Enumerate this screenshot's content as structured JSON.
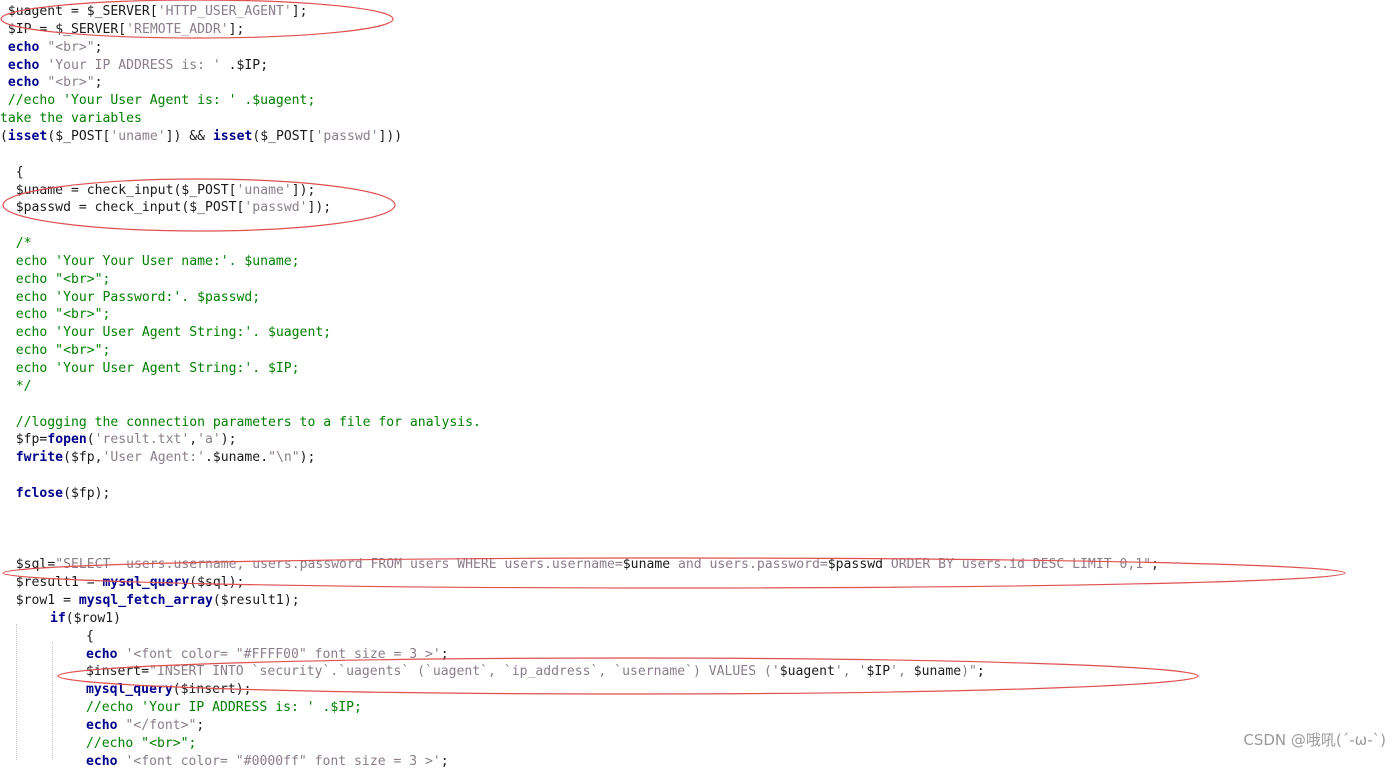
{
  "code_lines": [
    {
      "indent": 0,
      "tokens": [
        [
          "var",
          " $uagent"
        ],
        [
          "op",
          " = "
        ],
        [
          "var",
          "$_SERVER"
        ],
        [
          "punc",
          "["
        ],
        [
          "str",
          "'HTTP_USER_AGENT'"
        ],
        [
          "punc",
          "];"
        ]
      ]
    },
    {
      "indent": 0,
      "tokens": [
        [
          "var",
          " $IP"
        ],
        [
          "op",
          " = "
        ],
        [
          "var",
          "$_SERVER"
        ],
        [
          "punc",
          "["
        ],
        [
          "str",
          "'REMOTE_ADDR'"
        ],
        [
          "punc",
          "];"
        ]
      ]
    },
    {
      "indent": 0,
      "tokens": [
        [
          "kw",
          " echo"
        ],
        [
          "op",
          " "
        ],
        [
          "str",
          "\"<br>\""
        ],
        [
          "punc",
          ";"
        ]
      ]
    },
    {
      "indent": 0,
      "tokens": [
        [
          "kw",
          " echo"
        ],
        [
          "op",
          " "
        ],
        [
          "str",
          "'Your IP ADDRESS is: '"
        ],
        [
          "op",
          " ."
        ],
        [
          "var",
          "$IP"
        ],
        [
          "punc",
          ";"
        ]
      ]
    },
    {
      "indent": 0,
      "tokens": [
        [
          "kw",
          " echo"
        ],
        [
          "op",
          " "
        ],
        [
          "str",
          "\"<br>\""
        ],
        [
          "punc",
          ";"
        ]
      ]
    },
    {
      "indent": 0,
      "tokens": [
        [
          "cmt",
          " //echo 'Your User Agent is: ' .$uagent;"
        ]
      ]
    },
    {
      "indent": 0,
      "tokens": [
        [
          "cmt",
          "take the variables"
        ]
      ]
    },
    {
      "indent": 0,
      "tokens": [
        [
          "punc",
          "("
        ],
        [
          "kw",
          "isset"
        ],
        [
          "punc",
          "("
        ],
        [
          "var",
          "$_POST"
        ],
        [
          "punc",
          "["
        ],
        [
          "str",
          "'uname'"
        ],
        [
          "punc",
          "])"
        ],
        [
          "op",
          " && "
        ],
        [
          "kw",
          "isset"
        ],
        [
          "punc",
          "("
        ],
        [
          "var",
          "$_POST"
        ],
        [
          "punc",
          "["
        ],
        [
          "str",
          "'passwd'"
        ],
        [
          "punc",
          "]))"
        ]
      ]
    },
    {
      "indent": 0,
      "tokens": []
    },
    {
      "indent": 0,
      "tokens": [
        [
          "punc",
          "  {"
        ]
      ]
    },
    {
      "indent": 0,
      "tokens": [
        [
          "var",
          "  $uname"
        ],
        [
          "op",
          " = "
        ],
        [
          "fn",
          "check_input"
        ],
        [
          "punc",
          "("
        ],
        [
          "var",
          "$_POST"
        ],
        [
          "punc",
          "["
        ],
        [
          "str",
          "'uname'"
        ],
        [
          "punc",
          "]);"
        ]
      ]
    },
    {
      "indent": 0,
      "tokens": [
        [
          "var",
          "  $passwd"
        ],
        [
          "op",
          " = "
        ],
        [
          "fn",
          "check_input"
        ],
        [
          "punc",
          "("
        ],
        [
          "var",
          "$_POST"
        ],
        [
          "punc",
          "["
        ],
        [
          "str",
          "'passwd'"
        ],
        [
          "punc",
          "]);"
        ]
      ]
    },
    {
      "indent": 0,
      "tokens": []
    },
    {
      "indent": 0,
      "tokens": [
        [
          "cmt",
          "  /*"
        ]
      ]
    },
    {
      "indent": 0,
      "tokens": [
        [
          "cmt",
          "  echo 'Your Your User name:'. $uname;"
        ]
      ]
    },
    {
      "indent": 0,
      "tokens": [
        [
          "cmt",
          "  echo \"<br>\";"
        ]
      ]
    },
    {
      "indent": 0,
      "tokens": [
        [
          "cmt",
          "  echo 'Your Password:'. $passwd;"
        ]
      ]
    },
    {
      "indent": 0,
      "tokens": [
        [
          "cmt",
          "  echo \"<br>\";"
        ]
      ]
    },
    {
      "indent": 0,
      "tokens": [
        [
          "cmt",
          "  echo 'Your User Agent String:'. $uagent;"
        ]
      ]
    },
    {
      "indent": 0,
      "tokens": [
        [
          "cmt",
          "  echo \"<br>\";"
        ]
      ]
    },
    {
      "indent": 0,
      "tokens": [
        [
          "cmt",
          "  echo 'Your User Agent String:'. $IP;"
        ]
      ]
    },
    {
      "indent": 0,
      "tokens": [
        [
          "cmt",
          "  */"
        ]
      ]
    },
    {
      "indent": 0,
      "tokens": []
    },
    {
      "indent": 0,
      "tokens": [
        [
          "cmt",
          "  //logging the connection parameters to a file for analysis."
        ]
      ]
    },
    {
      "indent": 0,
      "tokens": [
        [
          "var",
          "  $fp"
        ],
        [
          "op",
          "="
        ],
        [
          "kw",
          "fopen"
        ],
        [
          "punc",
          "("
        ],
        [
          "str",
          "'result.txt'"
        ],
        [
          "punc",
          ","
        ],
        [
          "str",
          "'a'"
        ],
        [
          "punc",
          ");"
        ]
      ]
    },
    {
      "indent": 0,
      "tokens": [
        [
          "kw",
          "  fwrite"
        ],
        [
          "punc",
          "("
        ],
        [
          "var",
          "$fp"
        ],
        [
          "punc",
          ","
        ],
        [
          "str",
          "'User Agent:'"
        ],
        [
          "op",
          "."
        ],
        [
          "var",
          "$uname"
        ],
        [
          "op",
          "."
        ],
        [
          "str",
          "\"\\n\""
        ],
        [
          "punc",
          ");"
        ]
      ]
    },
    {
      "indent": 0,
      "tokens": []
    },
    {
      "indent": 0,
      "tokens": [
        [
          "kw",
          "  fclose"
        ],
        [
          "punc",
          "("
        ],
        [
          "var",
          "$fp"
        ],
        [
          "punc",
          ");"
        ]
      ]
    },
    {
      "indent": 0,
      "tokens": []
    },
    {
      "indent": 0,
      "tokens": []
    },
    {
      "indent": 0,
      "tokens": []
    },
    {
      "indent": 0,
      "tokens": [
        [
          "var",
          "  $sql"
        ],
        [
          "op",
          "="
        ],
        [
          "str",
          "\"SELECT  users.username, users.password FROM users WHERE users.username="
        ],
        [
          "var",
          "$uname"
        ],
        [
          "str",
          " and users.password="
        ],
        [
          "var",
          "$passwd"
        ],
        [
          "str",
          " ORDER BY users.id DESC LIMIT 0,1\""
        ],
        [
          "punc",
          ";"
        ]
      ]
    },
    {
      "indent": 0,
      "tokens": [
        [
          "var",
          "  $result1"
        ],
        [
          "op",
          " = "
        ],
        [
          "kw",
          "mysql_query"
        ],
        [
          "punc",
          "("
        ],
        [
          "var",
          "$sql"
        ],
        [
          "punc",
          ");"
        ]
      ]
    },
    {
      "indent": 0,
      "tokens": [
        [
          "var",
          "  $row1"
        ],
        [
          "op",
          " = "
        ],
        [
          "kw",
          "mysql_fetch_array"
        ],
        [
          "punc",
          "("
        ],
        [
          "var",
          "$result1"
        ],
        [
          "punc",
          ");"
        ]
      ]
    },
    {
      "indent": 1,
      "tokens": [
        [
          "kw",
          "if"
        ],
        [
          "punc",
          "("
        ],
        [
          "var",
          "$row1"
        ],
        [
          "punc",
          ")"
        ]
      ]
    },
    {
      "indent": 2,
      "tokens": [
        [
          "punc",
          "{"
        ]
      ]
    },
    {
      "indent": 2,
      "tokens": [
        [
          "kw",
          "echo"
        ],
        [
          "op",
          " "
        ],
        [
          "str",
          "'<font color= \"#FFFF00\" font size = 3 >'"
        ],
        [
          "punc",
          ";"
        ]
      ]
    },
    {
      "indent": 2,
      "tokens": [
        [
          "var",
          "$insert"
        ],
        [
          "op",
          "="
        ],
        [
          "str",
          "\"INSERT INTO `security`.`uagents` (`uagent`, `ip_address`, `username`) VALUES ('"
        ],
        [
          "var",
          "$uagent"
        ],
        [
          "str",
          "', '"
        ],
        [
          "var",
          "$IP"
        ],
        [
          "str",
          "', "
        ],
        [
          "var",
          "$uname"
        ],
        [
          "str",
          ")\""
        ],
        [
          "punc",
          ";"
        ]
      ]
    },
    {
      "indent": 2,
      "tokens": [
        [
          "kw",
          "mysql_query"
        ],
        [
          "punc",
          "("
        ],
        [
          "var",
          "$insert"
        ],
        [
          "punc",
          ");"
        ]
      ]
    },
    {
      "indent": 2,
      "tokens": [
        [
          "cmt",
          "//echo 'Your IP ADDRESS is: ' .$IP;"
        ]
      ]
    },
    {
      "indent": 2,
      "tokens": [
        [
          "kw",
          "echo"
        ],
        [
          "op",
          " "
        ],
        [
          "str",
          "\"</font>\""
        ],
        [
          "punc",
          ";"
        ]
      ]
    },
    {
      "indent": 2,
      "tokens": [
        [
          "cmt",
          "//echo \"<br>\";"
        ]
      ]
    },
    {
      "indent": 2,
      "tokens": [
        [
          "kw",
          "echo"
        ],
        [
          "op",
          " "
        ],
        [
          "str",
          "'<font color= \"#0000ff\" font size = 3 >'"
        ],
        [
          "punc",
          ";"
        ]
      ]
    }
  ],
  "colors": {
    "keyword": "#00008b",
    "string": "#8b7d8b",
    "comment": "#008000",
    "annotation": "#e05050"
  },
  "annotation_marks": [
    "red-ellipse-uagent-ip",
    "red-ellipse-uname-passwd",
    "red-ellipse-sql",
    "red-ellipse-insert"
  ],
  "watermark": "CSDN @哦吼(´-ω-`)"
}
